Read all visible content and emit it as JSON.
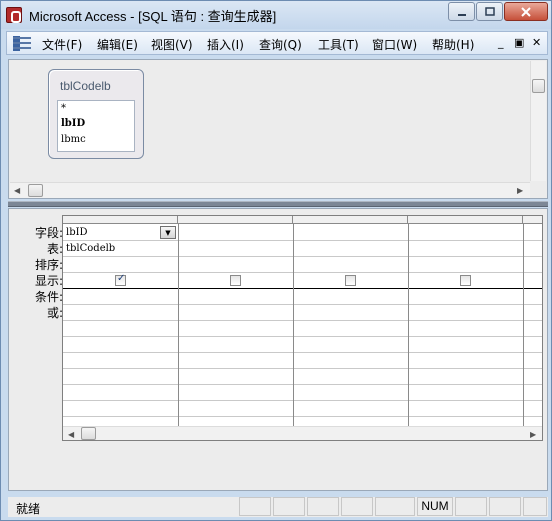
{
  "window": {
    "title": "Microsoft Access - [SQL 语句 : 查询生成器]",
    "min_label": "▭",
    "max_label": "□",
    "close_label": "✕"
  },
  "menu": {
    "items": [
      {
        "label": "文件(F)"
      },
      {
        "label": "编辑(E)"
      },
      {
        "label": "视图(V)"
      },
      {
        "label": "插入(I)"
      },
      {
        "label": "查询(Q)"
      },
      {
        "label": "工具(T)"
      },
      {
        "label": "窗口(W)"
      },
      {
        "label": "帮助(H)"
      }
    ],
    "mdi_min": "_",
    "mdi_restore": "▣",
    "mdi_close": "✕"
  },
  "table_box": {
    "title": "tblCodelb",
    "fields": [
      "*",
      "lbID",
      "lbmc"
    ]
  },
  "grid": {
    "row_labels": [
      "字段:",
      "表:",
      "排序:",
      "显示:",
      "条件:",
      "或:"
    ],
    "columns": [
      {
        "field": "lbID",
        "table": "tblCodelb",
        "sort": "",
        "show": true
      },
      {
        "field": "",
        "table": "",
        "sort": "",
        "show": false
      },
      {
        "field": "",
        "table": "",
        "sort": "",
        "show": false
      },
      {
        "field": "",
        "table": "",
        "sort": "",
        "show": false
      }
    ]
  },
  "statusbar": {
    "text": "就绪",
    "num": "NUM"
  }
}
